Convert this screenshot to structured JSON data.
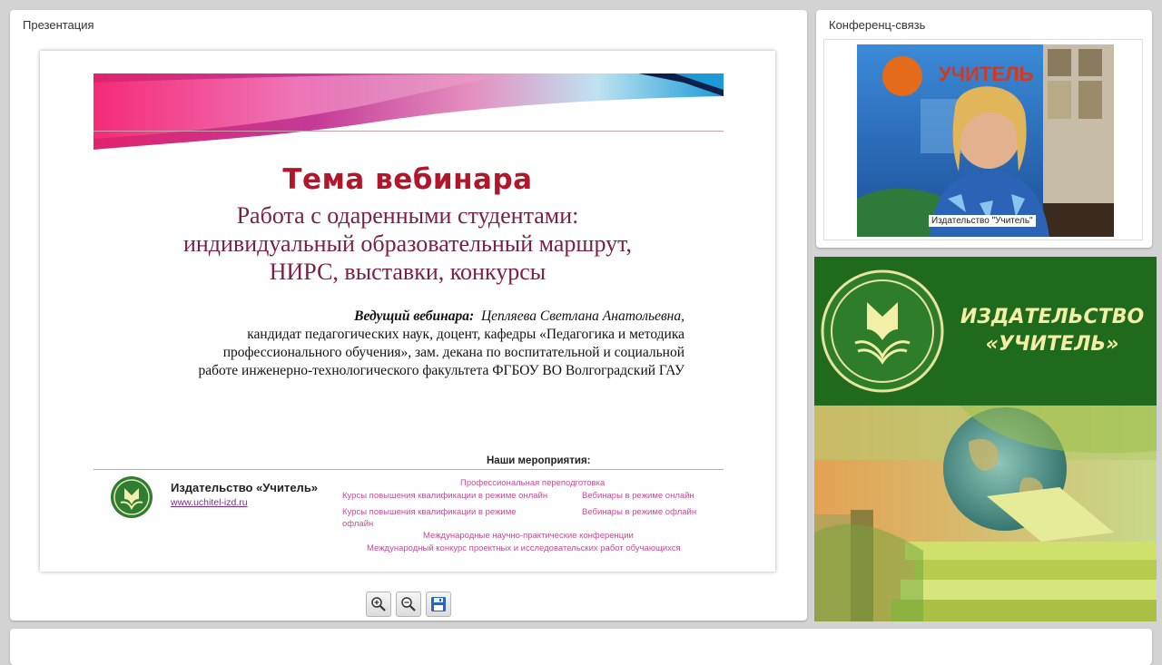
{
  "presentation": {
    "panel_title": "Презентация",
    "slide": {
      "heading": "Тема вебинара",
      "topic_lines": [
        "Работа с одаренными студентами:",
        "индивидуальный образовательный маршрут,",
        "НИРС, выставки, конкурсы"
      ],
      "presenter_label": "Ведущий вебинара",
      "presenter_name": "Цепляева Светлана Анатольевна,",
      "presenter_lines": [
        "кандидат педагогических наук,  доцент, кафедры «Педагогика и методика",
        "профессионального обучения», зам. декана по воспитательной и социальной",
        "работе инженерно-технологического факультета ФГБОУ ВО Волгоградский ГАУ"
      ],
      "events_title": "Наши мероприятия:",
      "publisher_name": "Издательство «Учитель»",
      "publisher_url": "www.uchitel-izd.ru",
      "events": [
        "Профессиональная переподготовка",
        "Курсы повышения квалификации в режиме онлайн",
        "Вебинары в режиме онлайн",
        "Курсы повышения квалификации в режиме",
        "офлайн",
        "Вебинары в режиме офлайн",
        "Международные научно-практические конференции",
        "Международный конкурс проектных и исследовательских работ обучающихся"
      ]
    },
    "toolbar": {
      "zoom_in_icon": "zoom-in-icon",
      "zoom_out_icon": "zoom-out-icon",
      "save_icon": "save-icon"
    }
  },
  "conference": {
    "panel_title": "Конференц-связь",
    "video_label": "Издательство \"Учитель\""
  },
  "publisher_banner": {
    "line1": "ИЗДАТЕЛЬСТВО",
    "line2": "«УЧИТЕЛЬ»"
  },
  "colors": {
    "heading": "#b0172b",
    "topic": "#7a1e4a",
    "banner_green": "#1f6a1c",
    "banner_text": "#f3efa6",
    "event_link": "#c04e93"
  }
}
